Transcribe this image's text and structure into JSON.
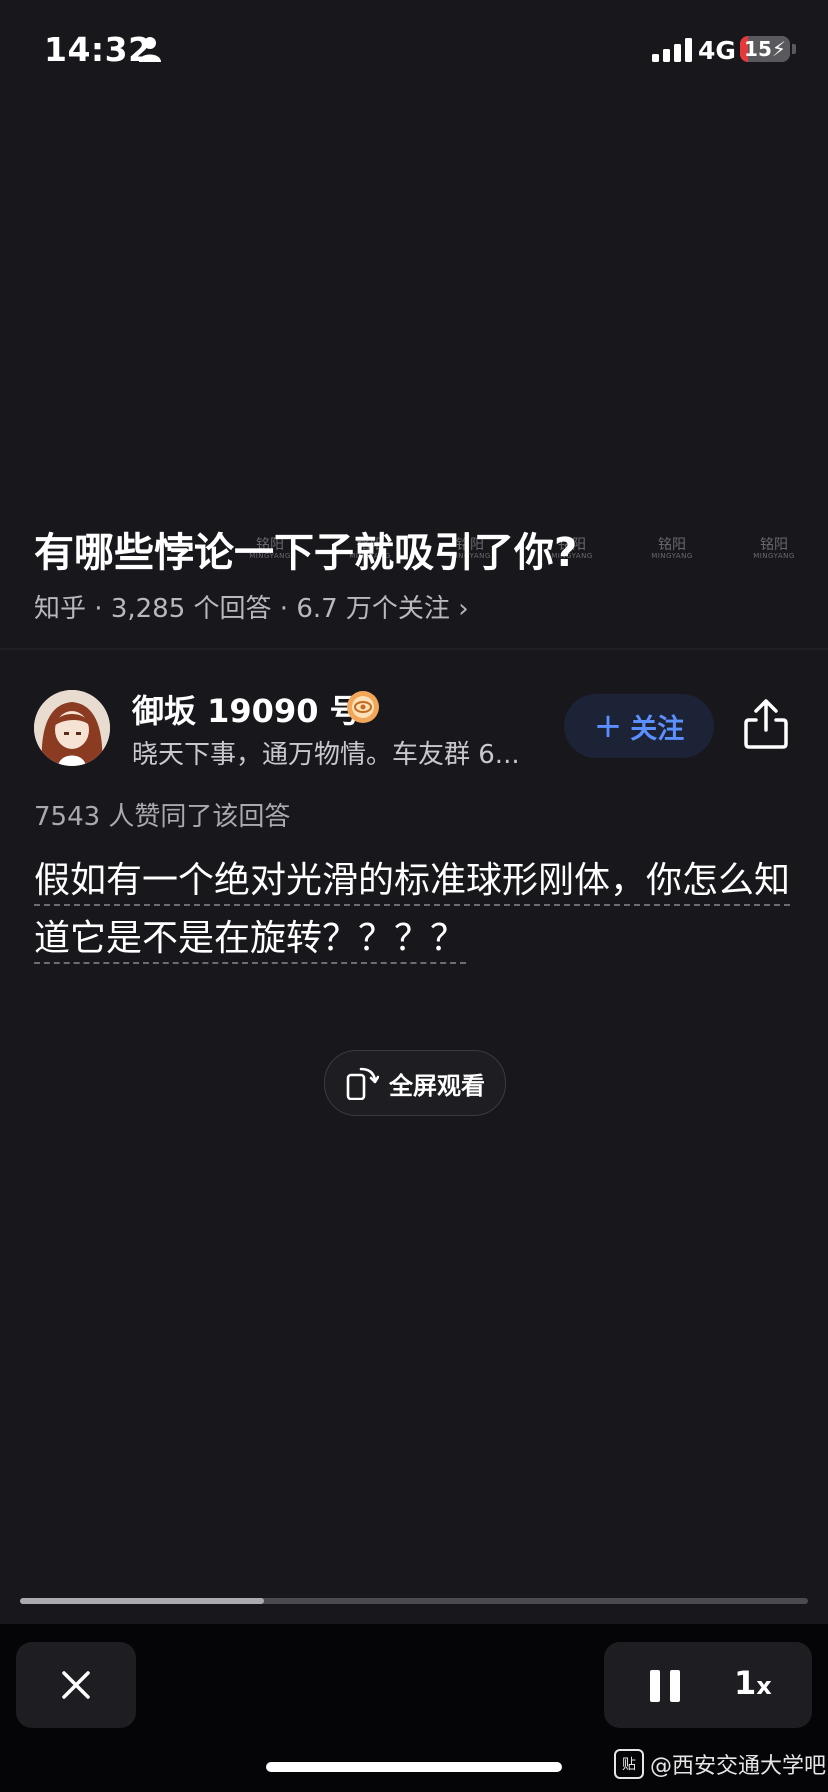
{
  "status_bar": {
    "time": "14:32",
    "network": "4G",
    "battery": "15",
    "battery_level": 0.15
  },
  "question": {
    "title": "有哪些悖论一下子就吸引了你?",
    "source": "知乎",
    "answers": "3,285 个回答",
    "followers": "6.7 万个关注",
    "separator": "·",
    "chevron": "›"
  },
  "watermarks": [
    {
      "cn": "铭阳",
      "en": "MINGYANG"
    },
    {
      "cn": "铭阳",
      "en": "MINGYANG"
    },
    {
      "cn": "铭阳",
      "en": "MINGYANG"
    },
    {
      "cn": "铭阳",
      "en": "MINGYANG"
    },
    {
      "cn": "铭阳",
      "en": "MINGYANG"
    },
    {
      "cn": "铭阳",
      "en": "MINGYANG"
    }
  ],
  "author": {
    "name": "御坂 19090 号",
    "bio": "晓天下事，通万物情。车友群 6...",
    "follow_label": "关注",
    "follow_plus": "+"
  },
  "likes_text": "7543 人赞同了该回答",
  "answer_text": "假如有一个绝对光滑的标准球形刚体，你怎么知道它是不是在旋转？？？？",
  "fullscreen_label": "全屏观看",
  "playback": {
    "progress": 0.31,
    "speed": "1",
    "speed_unit": "x"
  },
  "forum_watermark": "@西安交通大学吧",
  "forum_icon_text": "贴",
  "colors": {
    "background": "#17171c",
    "accent": "#5c8fff",
    "battery_low": "#e5393c"
  },
  "icons": [
    "person-icon",
    "signal-icon",
    "battery-icon",
    "badge-icon",
    "share-icon",
    "rotate-phone-icon",
    "close-icon",
    "pause-icon"
  ]
}
